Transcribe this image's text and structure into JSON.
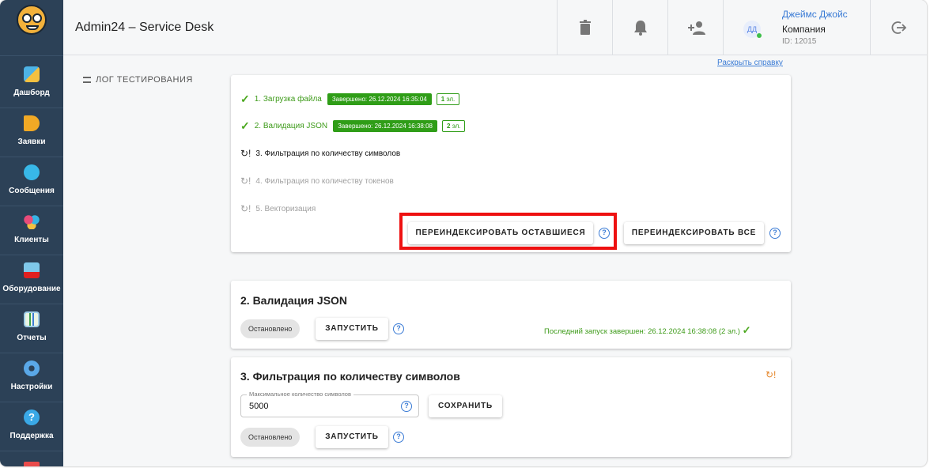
{
  "app": {
    "title": "Admin24 – Service Desk"
  },
  "sidebar": {
    "items": [
      {
        "label": "Дашборд",
        "icon": "dashboard-icon"
      },
      {
        "label": "Заявки",
        "icon": "megaphone-icon"
      },
      {
        "label": "Сообщения",
        "icon": "chat-icon"
      },
      {
        "label": "Клиенты",
        "icon": "clients-icon"
      },
      {
        "label": "Оборудование",
        "icon": "equipment-icon"
      },
      {
        "label": "Отчеты",
        "icon": "reports-icon"
      },
      {
        "label": "Настройки",
        "icon": "gear-icon"
      },
      {
        "label": "Поддержка",
        "icon": "help-icon"
      }
    ]
  },
  "user": {
    "initials": "ДД",
    "name": "Джеймс Джойс",
    "company": "Компания",
    "id": "ID: 12015"
  },
  "main": {
    "log_label": "ЛОГ ТЕСТИРОВАНИЯ",
    "help_link": "Раскрыть справку",
    "steps": [
      {
        "text": "1. Загрузка файла",
        "status": "done",
        "badge": "Завершено: 26.12.2024 16:35:04",
        "count_num": "1",
        "count_unit": "эл."
      },
      {
        "text": "2. Валидация JSON",
        "status": "done",
        "badge": "Завершено: 26.12.2024 16:38:08",
        "count_num": "2",
        "count_unit": "эл."
      },
      {
        "text": "3. Фильтрация по количеству символов",
        "status": "active"
      },
      {
        "text": "4. Фильтрация по количеству токенов",
        "status": "pending"
      },
      {
        "text": "5. Векторизация",
        "status": "pending"
      }
    ],
    "reindex_remaining": "ПЕРЕИНДЕКСИРОВАТЬ ОСТАВШИЕСЯ",
    "reindex_all": "ПЕРЕИНДЕКСИРОВАТЬ ВСЕ"
  },
  "card_json": {
    "title": "2. Валидация JSON",
    "status": "Остановлено",
    "run": "ЗАПУСТИТЬ",
    "last_run": "Последний запуск завершен: 26.12.2024 16:38:08 (2 эл.)"
  },
  "card_filter": {
    "title": "3. Фильтрация по количеству символов",
    "field_label": "Максимальное количество символов",
    "field_value": "5000",
    "save": "СОХРАНИТЬ",
    "status": "Остановлено",
    "run": "ЗАПУСТИТЬ"
  },
  "colors": {
    "sidebar": "#2c4157",
    "success": "#2f9d17",
    "link": "#3a7bd5",
    "highlight": "#e11111"
  }
}
